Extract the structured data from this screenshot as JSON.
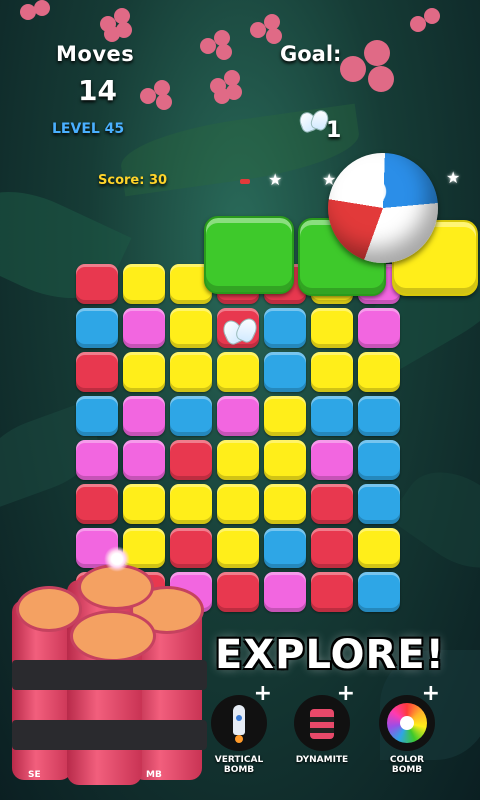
{
  "hud": {
    "moves_label": "Moves",
    "moves_value": "14",
    "level_label": "LEVEL 45",
    "goal_label": "Goal:",
    "goal_count": "1",
    "goal_icon": "butterfly-icon",
    "score_text": "Score: 30",
    "stars_filled": 0,
    "stars_total": 3
  },
  "board": {
    "rows": 8,
    "cols": 7,
    "grid": [
      [
        "red",
        "yellow",
        "yellow",
        "red",
        "red",
        "yellow",
        "pink"
      ],
      [
        "blue",
        "pink",
        "yellow",
        "red",
        "blue",
        "yellow",
        "pink"
      ],
      [
        "red",
        "yellow",
        "yellow",
        "yellow",
        "blue",
        "yellow",
        "yellow"
      ],
      [
        "blue",
        "pink",
        "blue",
        "pink",
        "yellow",
        "blue",
        "blue"
      ],
      [
        "pink",
        "pink",
        "red",
        "yellow",
        "yellow",
        "pink",
        "blue"
      ],
      [
        "red",
        "yellow",
        "yellow",
        "yellow",
        "yellow",
        "red",
        "blue"
      ],
      [
        "pink",
        "yellow",
        "red",
        "yellow",
        "blue",
        "red",
        "yellow"
      ],
      [
        "red",
        "red",
        "pink",
        "red",
        "pink",
        "red",
        "blue"
      ]
    ],
    "colors": {
      "red": "#e8384f",
      "yellow": "#ffee1a",
      "pink": "#f266e0",
      "blue": "#2ea6e6",
      "green": "#3ec92b"
    }
  },
  "promo": {
    "headline": "EXPLORE!"
  },
  "boosters": [
    {
      "name": "vertical-bomb",
      "label": "VERTICAL BOMB",
      "plus": "+",
      "icon": "rocket-icon"
    },
    {
      "name": "dynamite",
      "label": "DYNAMITE",
      "plus": "+",
      "icon": "dynamite-icon"
    },
    {
      "name": "color-bomb",
      "label": "COLOR BOMB",
      "plus": "+",
      "icon": "color-wheel-icon"
    }
  ],
  "partial_labels": {
    "left": "SE",
    "middle": "MB"
  }
}
